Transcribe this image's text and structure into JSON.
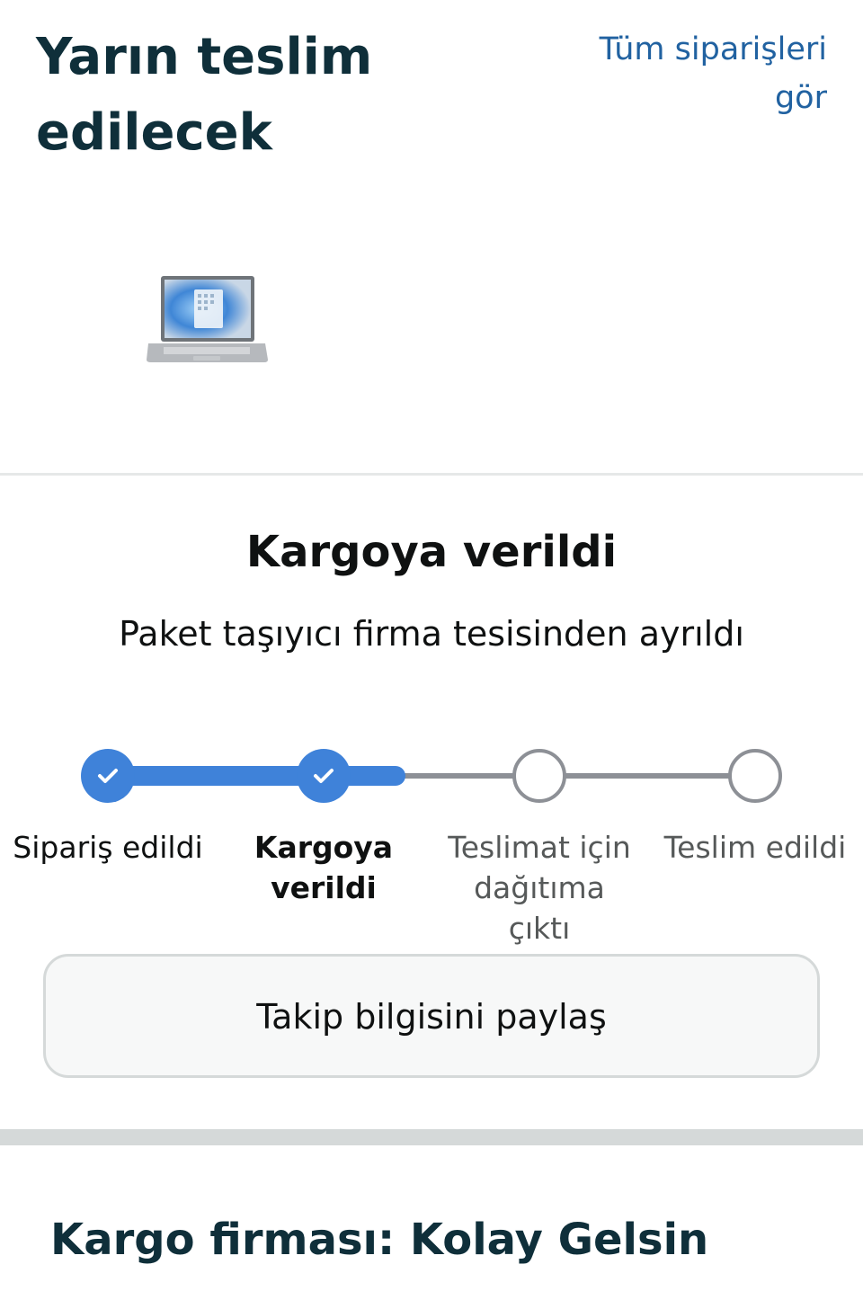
{
  "header": {
    "headline": "Yarın teslim edilecek",
    "all_orders_link": "Tüm siparişleri gör"
  },
  "product": {
    "thumbnail_icon": "laptop-icon"
  },
  "status": {
    "title": "Kargoya verildi",
    "subtitle": "Paket taşıyıcı firma tesisinden ayrıldı"
  },
  "tracker": {
    "steps": [
      {
        "label": "Sipariş edildi",
        "state": "done"
      },
      {
        "label": "Kargoya verildi",
        "state": "current"
      },
      {
        "label": "Teslimat için dağıtıma çıktı",
        "state": "pending"
      },
      {
        "label": "Teslim edildi",
        "state": "pending"
      }
    ],
    "progress_fraction": 0.46
  },
  "share_button": {
    "label": "Takip bilgisini paylaş"
  },
  "carrier": {
    "text": "Kargo firması: Kolay Gelsin"
  },
  "colors": {
    "accent": "#3f82d9",
    "link": "#2162a1",
    "pending": "#8d9096",
    "heading": "#0f2f3a"
  }
}
